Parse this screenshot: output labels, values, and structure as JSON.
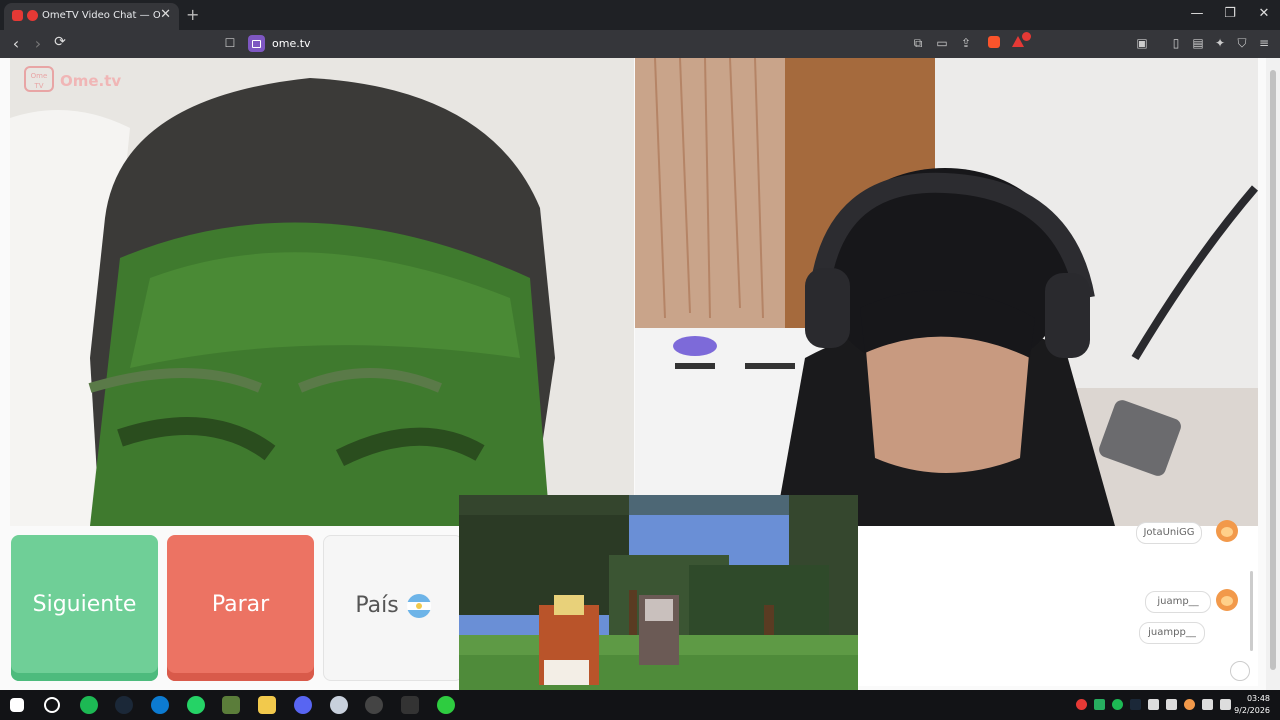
{
  "browser": {
    "tab_title": "OmeTV Video Chat — Omegle",
    "tab_close": "✕",
    "new_tab": "+",
    "url": "ome.tv",
    "window_controls": [
      "—",
      "❐",
      "✕"
    ],
    "nav": {
      "back": "‹",
      "forward": "›",
      "reload": "⟳"
    }
  },
  "site": {
    "logo_badge": "Ome TV",
    "logo_word": "Ome.tv"
  },
  "controls": {
    "next_label": "Siguiente",
    "stop_label": "Parar",
    "country_label": "País"
  },
  "chat": {
    "messages": [
      {
        "user": "JotaUniGG"
      },
      {
        "user": "juamp__"
      },
      {
        "user": "juampp__"
      }
    ]
  },
  "taskbar": {
    "time": "03:48",
    "date": "9/2/2026"
  },
  "colors": {
    "next": "#6fcf97",
    "stop": "#ec7363",
    "brand": "#f0b6b6"
  }
}
